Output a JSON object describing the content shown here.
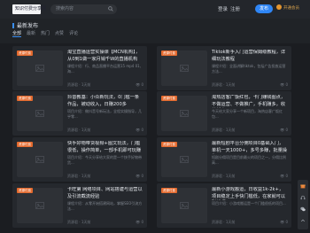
{
  "header": {
    "logo_text": "知识付费分享网",
    "search_placeholder": "搜索内容",
    "login_label": "登录",
    "register_label": "注册",
    "publish_label": "发布",
    "vip_label": "开通会员"
  },
  "section": {
    "title": "最新发布",
    "filters": [
      "全部",
      "最新",
      "热门",
      "点赞",
      "评论"
    ],
    "active_filter": "全部"
  },
  "cards": [
    {
      "tag": "资源付费",
      "title": "淘宝直播运营实操课【MCN机构】，从0到1做一家月销千W的直播机构",
      "desc": "课程介绍：行、商品直播平台运营15 mp4 01、海...",
      "author": "资源君",
      "time": "1天前",
      "views": "0"
    },
    {
      "tag": "资源付费",
      "title": "Tiktok新手入门运营保姆级教程，详细玩法教程",
      "desc": "课程介绍：全面讲解tiktok，包括广告投放运营方法...",
      "author": "资源君",
      "time": "1天前",
      "views": "0"
    },
    {
      "tag": "资源付费",
      "title": "抖音教基：小众新玩法，0门槛一条作品，被动收入，日赚200多",
      "desc": "项目介绍：做抖音号新玩法，全程实操指导，几乎零...",
      "author": "资源君",
      "time": "1天前",
      "views": "0"
    },
    {
      "tag": "资源付费",
      "title": "淘热店客广饭红包，卡门赚钱图点，不做运营、不做推广，手机赚多，收益越高",
      "desc": "今天给大家分享一个新项目，淘热店客广饭红包...",
      "author": "资源君",
      "time": "1天前",
      "views": "0"
    },
    {
      "tag": "资源付费",
      "title": "快手好物带货视频+图文玩法，门槛很低，操作简单，一部手机即可玩赚",
      "desc": "项目介绍：今天分享给大家的是一个快手好物带货...",
      "author": "资源君",
      "time": "1天前",
      "views": "0"
    },
    {
      "tag": "资源付费",
      "title": "最新短剧平台分佣项目0基础入门，单机一天1000+，多号多赚，批量操作",
      "desc": "短剧分佣项目是目前最火的项目之一，分佣比例高...",
      "author": "资源君",
      "time": "1天前",
      "views": "0"
    },
    {
      "tag": "资源付费",
      "title": "卡旺第 网络项目、网站搭建与运营以及引流截流经验",
      "desc": "课程介绍：从零开始搭建网站，掌握SEO引流方法...",
      "author": "资源君",
      "time": "1天前",
      "views": "0"
    },
    {
      "tag": "资源付费",
      "title": "最新小游戏搬运，日收益1k-2k+，项目稳定上手快门槛低，在家就可以赚钱项目",
      "desc": "项目介绍：小游戏搬运是一个门槛很低的项目...",
      "author": "资源君",
      "time": "1天前",
      "views": "0"
    }
  ],
  "float_bar": {
    "icons": [
      "gift-icon",
      "service-icon",
      "wechat-icon",
      "top-icon"
    ]
  },
  "colors": {
    "background": "#1b1d21",
    "card": "#25282d",
    "accent": "#2f86f6",
    "tag": "#e46a2e",
    "vip": "#d9a34c"
  }
}
